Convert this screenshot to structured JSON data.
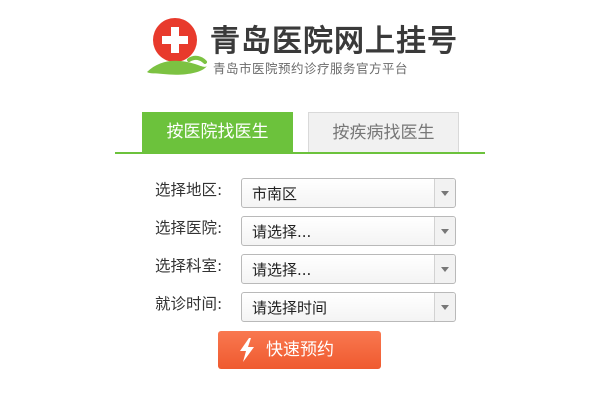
{
  "header": {
    "title": "青岛医院网上挂号",
    "subtitle": "青岛市医院预约诊疗服务官方平台",
    "logo_icon": "red-cross-hand-logo-icon"
  },
  "tabs": [
    {
      "label": "按医院找医生",
      "active": true
    },
    {
      "label": "按疾病找医生",
      "active": false
    }
  ],
  "form": {
    "region": {
      "label": "选择地区:",
      "value": "市南区"
    },
    "hospital": {
      "label": "选择医院:",
      "value": "请选择..."
    },
    "department": {
      "label": "选择科室:",
      "value": "请选择..."
    },
    "time": {
      "label": "就诊时间:",
      "value": "请选择时间"
    }
  },
  "submit": {
    "label": "快速预约",
    "icon": "lightning-icon"
  },
  "colors": {
    "accent_green": "#6cc23c",
    "button_orange": "#f26436",
    "logo_red": "#e83a2c"
  }
}
